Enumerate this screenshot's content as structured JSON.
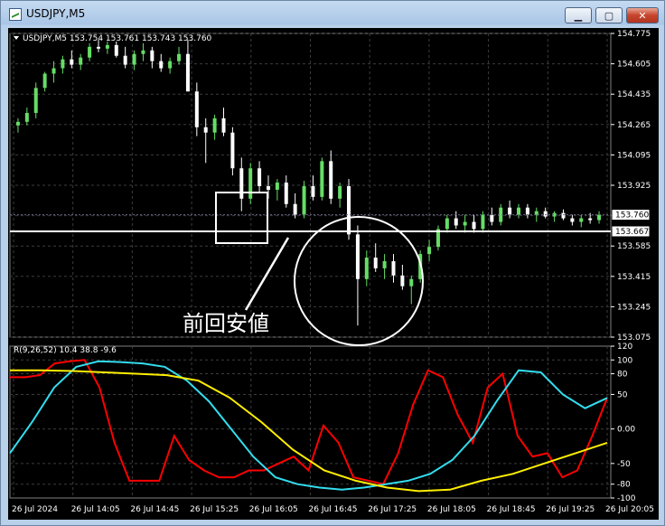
{
  "window": {
    "title": "USDJPY,M5",
    "buttons": {
      "minimize": "▁",
      "maximize": "▢",
      "close": "✕"
    }
  },
  "chart": {
    "symbol_info": "USDJPY,M5  153.754 153.761 153.743 153.760",
    "bid_label": "153.760",
    "hline_label": "153.667",
    "annotation": "前回安値",
    "indicator_label": "R(9,26,52) 10.4 38.8 -9.6",
    "price_ticks": [
      "154.775",
      "154.605",
      "154.435",
      "154.265",
      "154.095",
      "153.925",
      "153.755",
      "153.585",
      "153.415",
      "153.245",
      "153.075"
    ],
    "indicator_ticks": [
      "120",
      "100",
      "80",
      "50",
      "0.00",
      "-50",
      "-80",
      "-100"
    ],
    "time_ticks": [
      "26 Jul 2024",
      "26 Jul 14:05",
      "26 Jul 14:45",
      "26 Jul 15:25",
      "26 Jul 16:05",
      "26 Jul 16:45",
      "26 Jul 17:25",
      "26 Jul 18:05",
      "26 Jul 18:45",
      "26 Jul 19:25",
      "26 Jul 20:05"
    ],
    "colors": {
      "bull": "#66dd66",
      "bear": "#ffffff",
      "red_line": "#ff0000",
      "cyan_line": "#33ddee",
      "yellow_line": "#ffee00",
      "grid": "#3c3c3c"
    }
  },
  "chart_data": {
    "type": "line",
    "title": "USDJPY,M5",
    "candles_ohlc": [
      [
        154.26,
        154.3,
        154.22,
        154.28
      ],
      [
        154.28,
        154.36,
        154.26,
        154.33
      ],
      [
        154.33,
        154.5,
        154.3,
        154.47
      ],
      [
        154.47,
        154.56,
        154.45,
        154.55
      ],
      [
        154.55,
        154.62,
        154.5,
        154.58
      ],
      [
        154.58,
        154.65,
        154.55,
        154.63
      ],
      [
        154.63,
        154.68,
        154.58,
        154.6
      ],
      [
        154.6,
        154.66,
        154.57,
        154.64
      ],
      [
        154.64,
        154.72,
        154.62,
        154.7
      ],
      [
        154.7,
        154.74,
        154.67,
        154.69
      ],
      [
        154.69,
        154.73,
        154.66,
        154.71
      ],
      [
        154.71,
        154.73,
        154.64,
        154.65
      ],
      [
        154.65,
        154.7,
        154.58,
        154.6
      ],
      [
        154.6,
        154.68,
        154.57,
        154.66
      ],
      [
        154.66,
        154.72,
        154.62,
        154.68
      ],
      [
        154.68,
        154.7,
        154.58,
        154.62
      ],
      [
        154.62,
        154.66,
        154.56,
        154.58
      ],
      [
        154.58,
        154.64,
        154.55,
        154.62
      ],
      [
        154.62,
        154.7,
        154.6,
        154.66
      ],
      [
        154.66,
        154.74,
        154.55,
        154.45
      ],
      [
        154.45,
        154.5,
        154.2,
        154.25
      ],
      [
        154.25,
        154.3,
        154.05,
        154.22
      ],
      [
        154.22,
        154.32,
        154.18,
        154.3
      ],
      [
        154.3,
        154.36,
        154.2,
        154.22
      ],
      [
        154.22,
        154.25,
        153.98,
        154.02
      ],
      [
        154.02,
        154.08,
        153.78,
        153.85
      ],
      [
        153.85,
        154.05,
        153.82,
        154.02
      ],
      [
        154.02,
        154.06,
        153.88,
        153.92
      ],
      [
        153.92,
        153.98,
        153.85,
        153.9
      ],
      [
        153.9,
        153.96,
        153.84,
        153.94
      ],
      [
        153.94,
        153.98,
        153.8,
        153.82
      ],
      [
        153.82,
        153.88,
        153.74,
        153.76
      ],
      [
        153.76,
        153.95,
        153.74,
        153.92
      ],
      [
        153.92,
        153.98,
        153.84,
        153.86
      ],
      [
        153.86,
        154.08,
        153.84,
        154.06
      ],
      [
        154.06,
        154.12,
        153.82,
        153.85
      ],
      [
        153.85,
        153.94,
        153.8,
        153.92
      ],
      [
        153.92,
        153.96,
        153.62,
        153.65
      ],
      [
        153.65,
        153.7,
        153.14,
        153.4
      ],
      [
        153.4,
        153.56,
        153.36,
        153.52
      ],
      [
        153.52,
        153.6,
        153.44,
        153.46
      ],
      [
        153.46,
        153.54,
        153.4,
        153.5
      ],
      [
        153.5,
        153.54,
        153.38,
        153.42
      ],
      [
        153.42,
        153.48,
        153.34,
        153.36
      ],
      [
        153.36,
        153.42,
        153.26,
        153.4
      ],
      [
        153.4,
        153.56,
        153.38,
        153.54
      ],
      [
        153.54,
        153.62,
        153.5,
        153.58
      ],
      [
        153.58,
        153.7,
        153.56,
        153.68
      ],
      [
        153.68,
        153.76,
        153.66,
        153.74
      ],
      [
        153.74,
        153.78,
        153.68,
        153.7
      ],
      [
        153.7,
        153.76,
        153.66,
        153.72
      ],
      [
        153.72,
        153.76,
        153.66,
        153.68
      ],
      [
        153.68,
        153.78,
        153.66,
        153.76
      ],
      [
        153.76,
        153.8,
        153.7,
        153.72
      ],
      [
        153.72,
        153.82,
        153.7,
        153.8
      ],
      [
        153.8,
        153.84,
        153.74,
        153.76
      ],
      [
        153.76,
        153.82,
        153.74,
        153.8
      ],
      [
        153.8,
        153.82,
        153.74,
        153.76
      ],
      [
        153.76,
        153.8,
        153.72,
        153.78
      ],
      [
        153.78,
        153.8,
        153.74,
        153.75
      ],
      [
        153.75,
        153.78,
        153.72,
        153.77
      ],
      [
        153.77,
        153.79,
        153.73,
        153.74
      ],
      [
        153.74,
        153.76,
        153.7,
        153.72
      ],
      [
        153.72,
        153.76,
        153.69,
        153.74
      ],
      [
        153.74,
        153.77,
        153.71,
        153.73
      ],
      [
        153.73,
        153.78,
        153.71,
        153.76
      ]
    ],
    "price_ylim": [
      153.075,
      154.775
    ],
    "indicator_ylim": [
      -100,
      120
    ],
    "series": [
      {
        "name": "",
        "color": "#ff0000",
        "values": [
          75,
          75,
          78,
          95,
          98,
          100,
          60,
          -20,
          -75,
          -75,
          -75,
          -10,
          -45,
          -60,
          -70,
          -70,
          -60,
          -60,
          -50,
          -40,
          -60,
          5,
          -20,
          -70,
          -75,
          -80,
          -35,
          35,
          85,
          75,
          20,
          -20,
          60,
          80,
          -10,
          -40,
          -35,
          -70,
          -60,
          -10,
          45
        ]
      },
      {
        "name": "",
        "color": "#33ddee",
        "values": [
          -35,
          10,
          60,
          90,
          98,
          97,
          95,
          90,
          70,
          40,
          0,
          -40,
          -70,
          -80,
          -85,
          -88,
          -85,
          -80,
          -75,
          -65,
          -45,
          -10,
          40,
          85,
          82,
          50,
          30,
          45
        ]
      },
      {
        "name": "",
        "color": "#ffee00",
        "values": [
          85,
          85,
          84,
          82,
          80,
          78,
          70,
          45,
          10,
          -30,
          -60,
          -75,
          -85,
          -90,
          -88,
          -75,
          -65,
          -50,
          -35,
          -20
        ]
      }
    ]
  }
}
